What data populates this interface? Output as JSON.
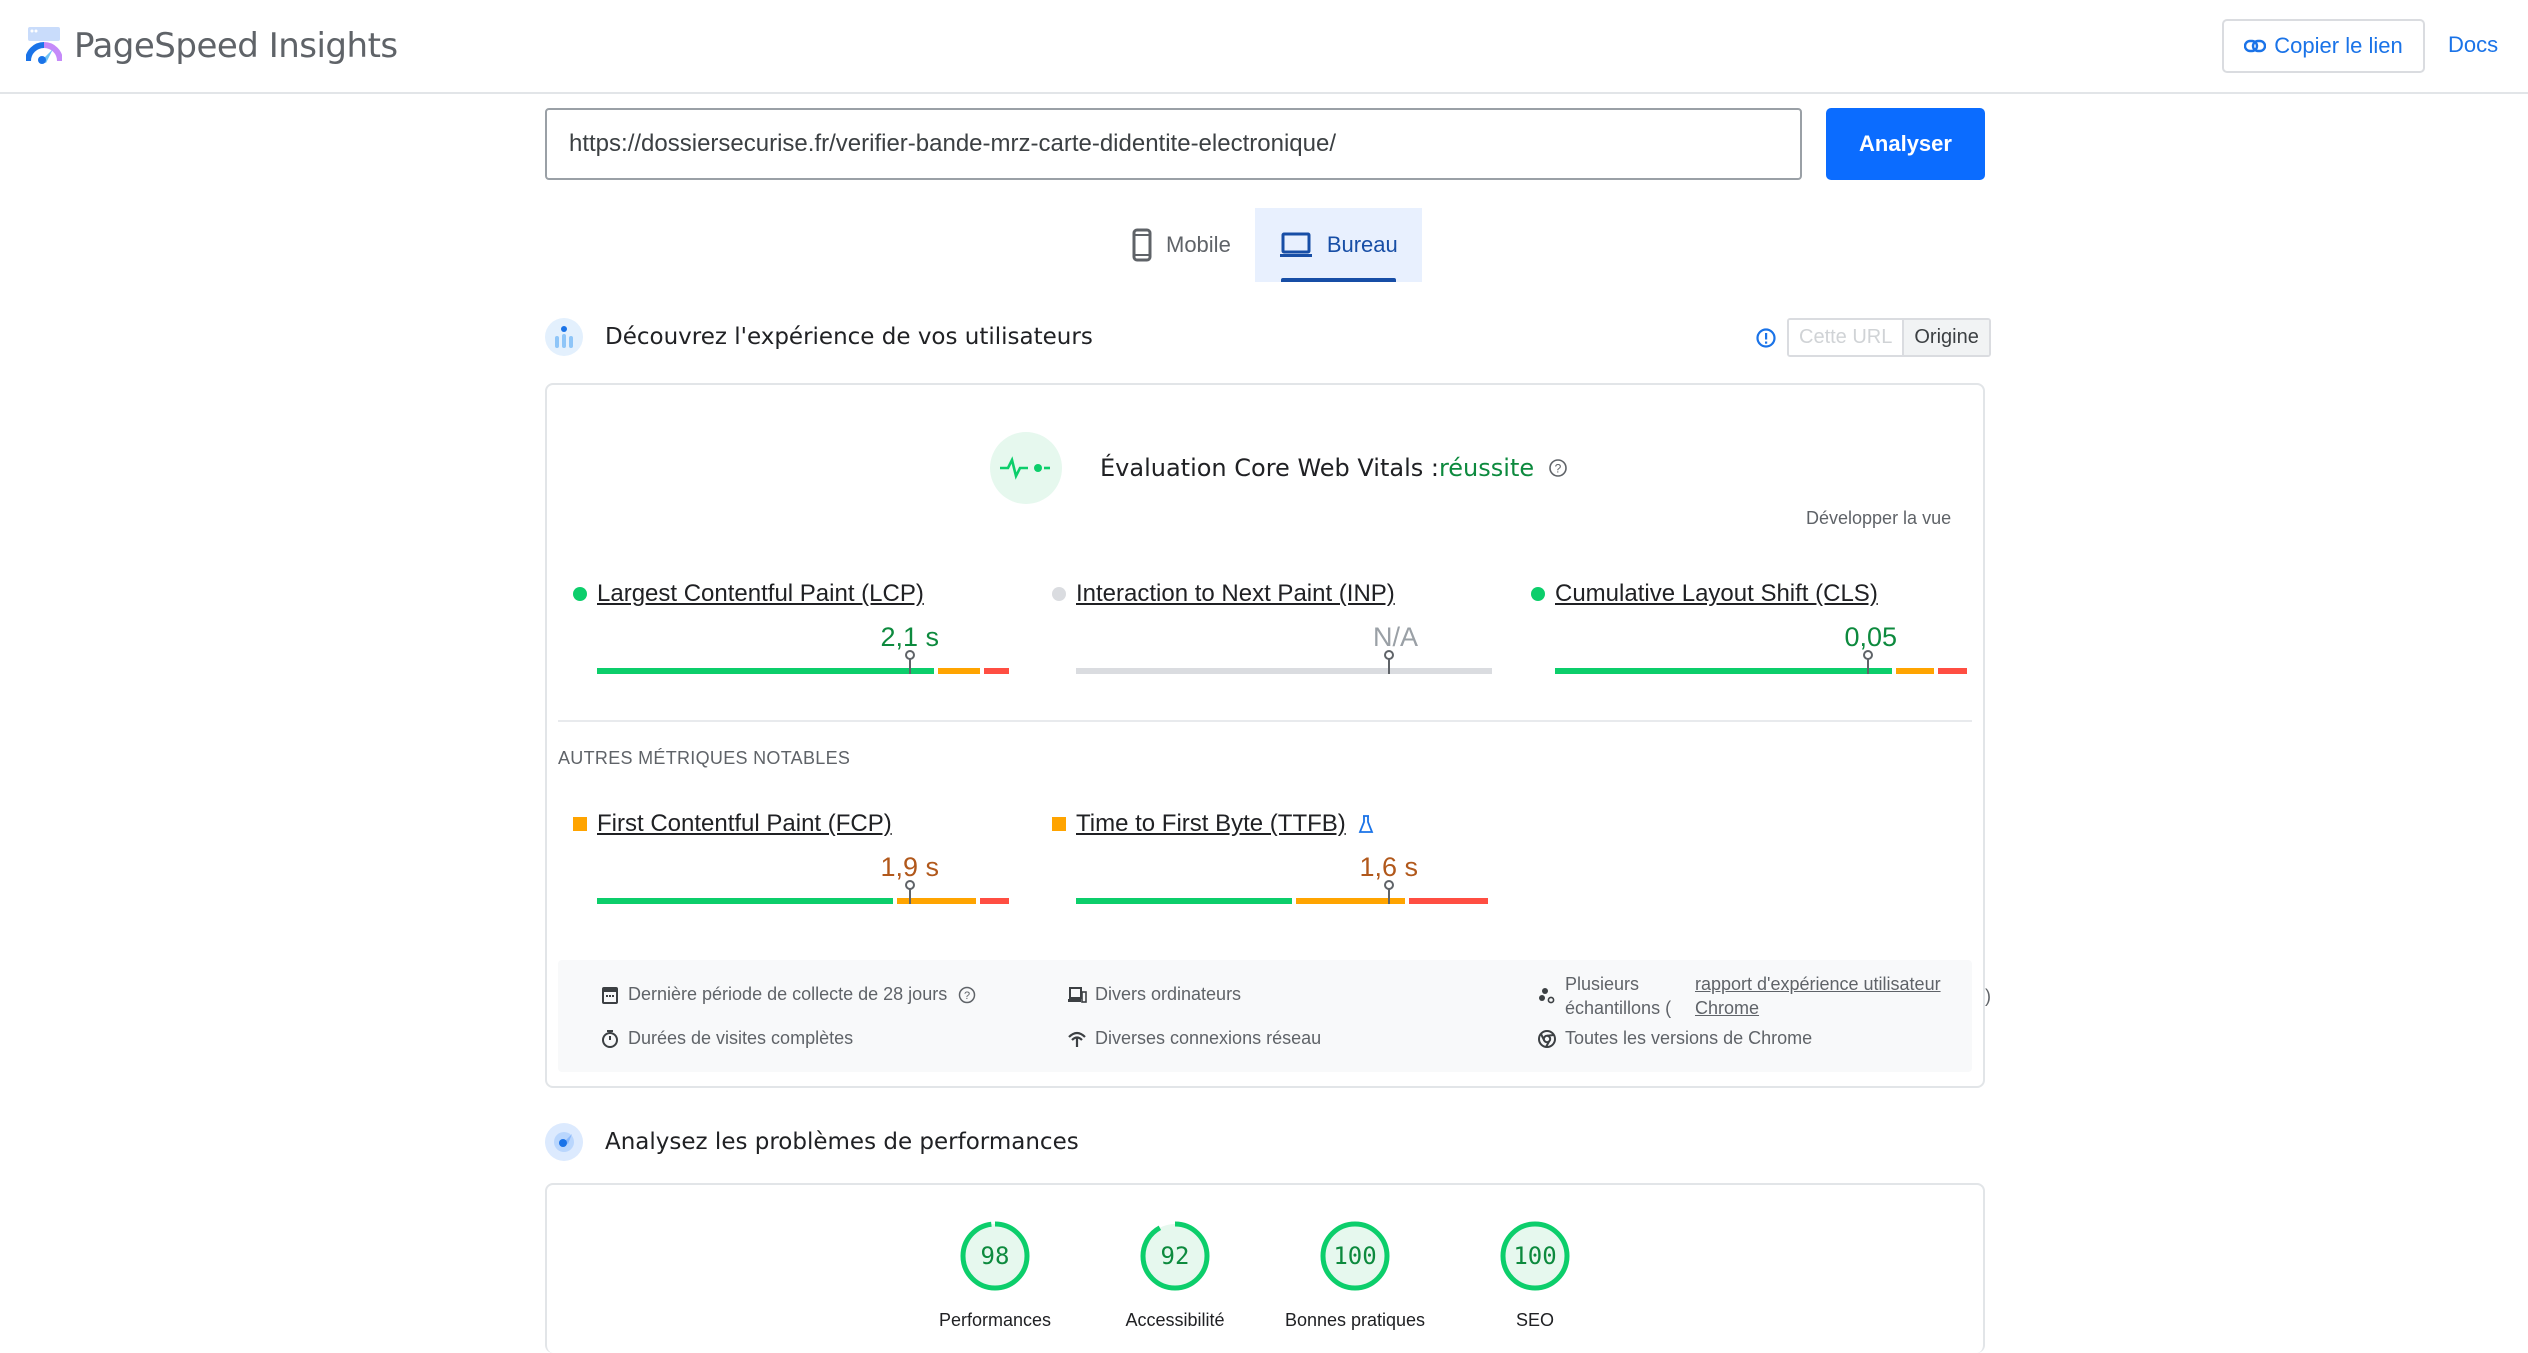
{
  "header": {
    "app_title": "PageSpeed Insights",
    "copy_link_label": "Copier le lien",
    "docs_label": "Docs"
  },
  "search": {
    "url_value": "https://dossiersecurise.fr/verifier-bande-mrz-carte-didentite-electronique/",
    "analyze_label": "Analyser"
  },
  "device_tabs": [
    {
      "label": "Mobile",
      "icon": "phone-icon",
      "active": false
    },
    {
      "label": "Bureau",
      "icon": "laptop-icon",
      "active": true
    }
  ],
  "field_section": {
    "title": "Découvrez l'expérience de vos utilisateurs",
    "toggle": {
      "option_url": "Cette URL",
      "option_origin": "Origine",
      "selected": "Origine"
    },
    "cwv": {
      "label": "Évaluation Core Web Vitals :",
      "status": "réussite",
      "status_color": "#0d8a3e"
    },
    "expand_label": "Développer la vue",
    "core_metrics": [
      {
        "name": "Largest Contentful Paint (LCP)",
        "value": "2,1 s",
        "rating": "good",
        "marker_pct": 75,
        "dist": {
          "good": 0.82,
          "ni": 0.11,
          "poor": 0.07
        }
      },
      {
        "name": "Interaction to Next Paint (INP)",
        "value": "N/A",
        "rating": "na",
        "marker_pct": 75,
        "dist": null
      },
      {
        "name": "Cumulative Layout Shift (CLS)",
        "value": "0,05",
        "rating": "good",
        "marker_pct": 75,
        "dist": {
          "good": 0.82,
          "ni": 0.1,
          "poor": 0.08
        }
      }
    ],
    "other_label": "AUTRES MÉTRIQUES NOTABLES",
    "other_metrics": [
      {
        "name": "First Contentful Paint (FCP)",
        "value": "1,9 s",
        "rating": "average",
        "marker_pct": 75,
        "experimental": false,
        "dist": {
          "good": 0.72,
          "ni": 0.2,
          "poor": 0.08
        }
      },
      {
        "name": "Time to First Byte (TTFB)",
        "value": "1,6 s",
        "rating": "average",
        "marker_pct": 75,
        "experimental": true,
        "dist": {
          "good": 0.53,
          "ni": 0.27,
          "poor": 0.2
        }
      }
    ],
    "footer": {
      "period": "Dernière période de collecte de 28 jours",
      "visits": "Durées de visites complètes",
      "devices": "Divers ordinateurs",
      "network": "Diverses connexions réseau",
      "samples_prefix": "Plusieurs échantillons (",
      "samples_link": "rapport d'expérience utilisateur Chrome",
      "samples_suffix": ")",
      "chrome": "Toutes les versions de Chrome"
    }
  },
  "lab_section": {
    "title": "Analysez les problèmes de performances",
    "scores": [
      {
        "label": "Performances",
        "score": 98
      },
      {
        "label": "Accessibilité",
        "score": 92
      },
      {
        "label": "Bonnes pratiques",
        "score": 100
      },
      {
        "label": "SEO",
        "score": 100
      }
    ]
  },
  "colors": {
    "good": "#0cce6b",
    "average": "#ffa400",
    "poor": "#ff4e42",
    "na": "#dadce0",
    "good_text": "#0d8a3e",
    "average_text": "#b1581b",
    "na_text": "#9aa0a6",
    "accent": "#1a73e8"
  }
}
